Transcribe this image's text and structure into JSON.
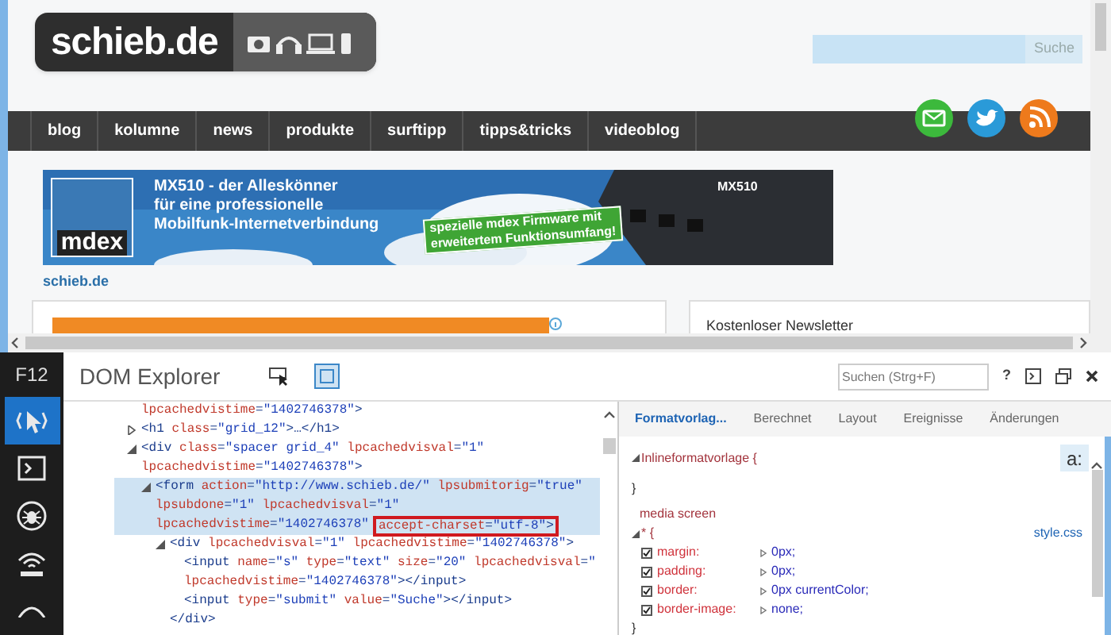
{
  "page": {
    "logo": "schieb.de",
    "search": {
      "button": "Suche"
    },
    "nav": [
      "blog",
      "kolumne",
      "news",
      "produkte",
      "surftipp",
      "tipps&tricks",
      "videoblog"
    ],
    "banner": {
      "brand": "mdex",
      "headline": [
        "MX510 - der Alleskönner",
        "für eine professionelle",
        "Mobilfunk-Internetverbindung"
      ],
      "badge": [
        "spezielle mdex Firmware mit",
        "erweitertem Funktionsumfang!"
      ],
      "device_label": "MX510"
    },
    "site_link": "schieb.de",
    "newsletter_title": "Kostenloser Newsletter"
  },
  "devtools": {
    "key": "F12",
    "title": "DOM Explorer",
    "search": {
      "placeholder": "Suchen (Strg+F)"
    },
    "help": "?",
    "tools": [
      {
        "kind": "select",
        "selected": true
      },
      {
        "kind": "console",
        "selected": false
      },
      {
        "kind": "debugger",
        "selected": false
      },
      {
        "kind": "network",
        "selected": false
      },
      {
        "kind": "profiler",
        "selected": false
      }
    ],
    "dom_tree": [
      {
        "lines": [
          "lpcachedvistime=\"1402746378\">"
        ]
      },
      {
        "expanded": false,
        "lines": [
          "<h1 class=\"grid_12\">…</h1>"
        ]
      },
      {
        "expanded": true,
        "lines": [
          "<div class=\"spacer grid_4\" lpcachedvisval=\"1\"",
          "lpcachedvistime=\"1402746378\">"
        ],
        "children": [
          {
            "expanded": true,
            "selected": true,
            "lines": [
              "<form action=\"http://www.schieb.de/\" lpsubmitorig=\"true\"",
              "lpsubdone=\"1\" lpcachedvisval=\"1\"",
              "lpcachedvistime=\"1402746378\""
            ],
            "boxed": "accept-charset=\"utf-8\">",
            "children": [
              {
                "expanded": true,
                "lines": [
                  "<div lpcachedvisval=\"1\" lpcachedvistime=\"1402746378\">"
                ],
                "close": "</div>",
                "children": [
                  {
                    "lines": [
                      "<input name=\"s\" type=\"text\" size=\"20\" lpcachedvisval=\"",
                      "lpcachedvistime=\"1402746378\"></input>"
                    ]
                  },
                  {
                    "lines": [
                      "<input type=\"submit\" value=\"Suche\"></input>"
                    ]
                  }
                ]
              }
            ]
          }
        ]
      }
    ],
    "style_tabs": [
      {
        "label": "Formatvorlag...",
        "selected": true
      },
      {
        "label": "Berechnet",
        "selected": false
      },
      {
        "label": "Layout",
        "selected": false
      },
      {
        "label": "Ereignisse",
        "selected": false
      },
      {
        "label": "Änderungen",
        "selected": false
      }
    ],
    "state_button": "a:",
    "inline_rule": {
      "selector": "Inlineformatvorlage",
      "open": "{",
      "close": "}"
    },
    "media": "media screen",
    "rule": {
      "selector": "*",
      "open": "{",
      "source": "style.css",
      "close": "}",
      "properties": [
        {
          "name": "margin:",
          "value": "0px;",
          "checked": true
        },
        {
          "name": "padding:",
          "value": "0px;",
          "checked": true
        },
        {
          "name": "border:",
          "value": "0px currentColor;",
          "checked": true
        },
        {
          "name": "border-image:",
          "value": "none;",
          "checked": true
        }
      ]
    }
  }
}
